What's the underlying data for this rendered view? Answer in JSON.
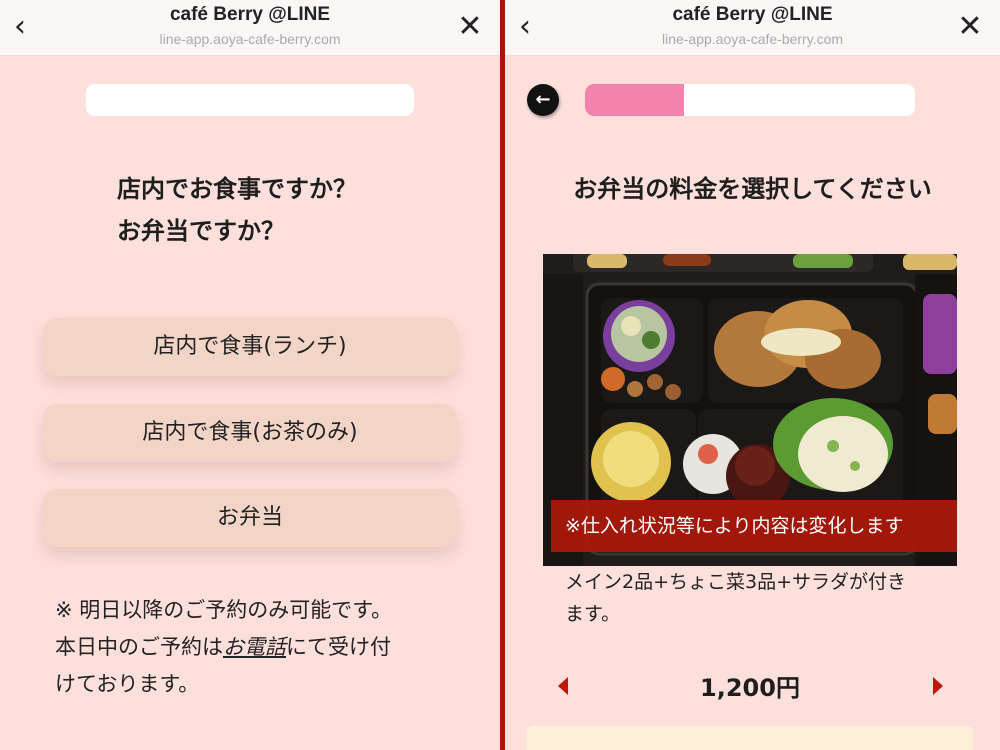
{
  "left": {
    "titlebar": {
      "title": "café Berry @LINE",
      "url": "line-app.aoya-cafe-berry.com"
    },
    "question_line1": "店内でお食事ですか？",
    "question_line2": "お弁当ですか？",
    "choices": [
      {
        "label": "店内で食事(ランチ)"
      },
      {
        "label": "店内で食事(お茶のみ)"
      },
      {
        "label": "お弁当"
      }
    ],
    "note": {
      "line1": "※ 明日以降のご予約のみ可能です。",
      "line2_pre": "本日中のご予約は",
      "line2_link": "お電話",
      "line2_post": "にて受け付",
      "line3": "けております。"
    }
  },
  "right": {
    "titlebar": {
      "title": "café Berry @LINE",
      "url": "line-app.aoya-cafe-berry.com"
    },
    "progress_fraction": 0.3,
    "heading": "お弁当の料金を選択してください",
    "photo_caption": "※仕入れ状況等により内容は変化します",
    "description_line1": "メイン2品+ちょこ菜3品+サラダが付き",
    "description_line2": "ます。",
    "price": "1,200円"
  },
  "colors": {
    "background": "#fde0dc",
    "progress_fill": "#f383ad",
    "button": "#f3d5c8",
    "divider": "#a8150c",
    "caption_bg": "#ac180a",
    "arrow": "#c0150a"
  },
  "icons": {
    "back": "chevron-left-icon",
    "close": "close-icon",
    "step_back": "arrow-left-circle-icon",
    "prev_price": "triangle-left-icon",
    "next_price": "triangle-right-icon"
  }
}
